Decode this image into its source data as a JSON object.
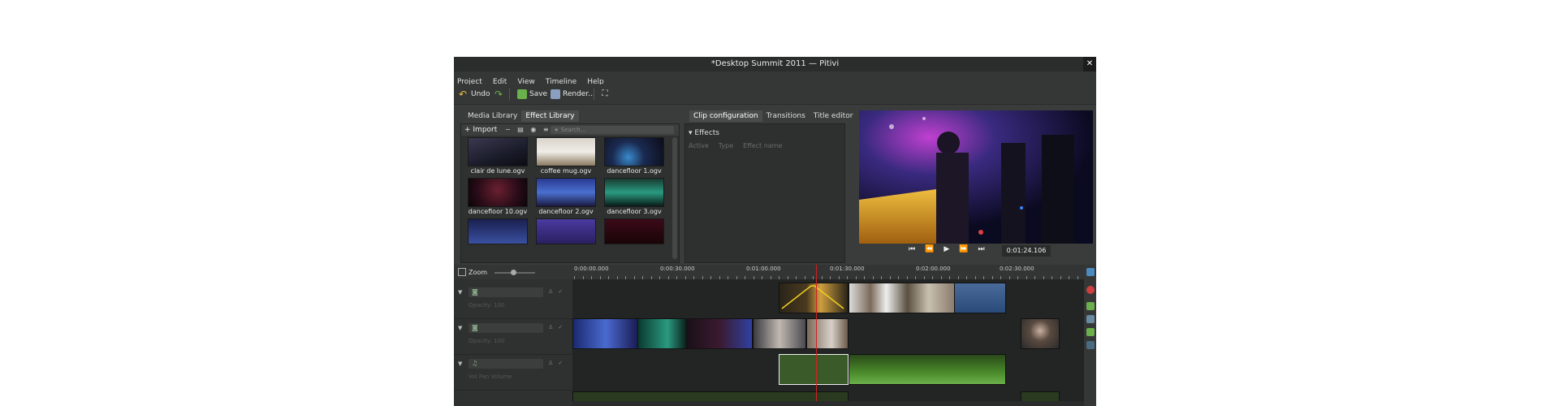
{
  "window": {
    "title": "*Desktop Summit 2011 — Pitivi",
    "close_glyph": "✕"
  },
  "menu": [
    "Project",
    "Edit",
    "View",
    "Timeline",
    "Help"
  ],
  "toolbar": {
    "undo": "Undo",
    "save": "Save",
    "render": "Render..."
  },
  "left_tabs": [
    "Media Library",
    "Effect Library"
  ],
  "media_library": {
    "import_label": "Import",
    "search_placeholder": "Search...",
    "clips": [
      "clair de lune.ogv",
      "coffee mug.ogv",
      "dancefloor 1.ogv",
      "dancefloor 10.ogv",
      "dancefloor 2.ogv",
      "dancefloor 3.ogv"
    ]
  },
  "mid_tabs": [
    "Clip configuration",
    "Transitions",
    "Title editor"
  ],
  "clip_config": {
    "effects_label": "Effects",
    "columns": [
      "Active",
      "Type",
      "Effect name"
    ]
  },
  "viewer": {
    "timecode": "0:01:24.106"
  },
  "timeline": {
    "zoom_label": "Zoom",
    "ruler": [
      "0:00:00.000",
      "0:00:30.000",
      "0:01:00.000",
      "0:01:30.000",
      "0:02:00.000",
      "0:02:30.000"
    ],
    "tracks": [
      {
        "kind": "video",
        "opacity": "Opacity: 100"
      },
      {
        "kind": "video",
        "opacity": "Opacity: 100"
      },
      {
        "kind": "audio",
        "opacity": "Vol  Pan  Volume"
      }
    ]
  },
  "colors": {
    "accent": "#6ab04c",
    "playhead": "#d42020",
    "selection": "#f0d020"
  }
}
